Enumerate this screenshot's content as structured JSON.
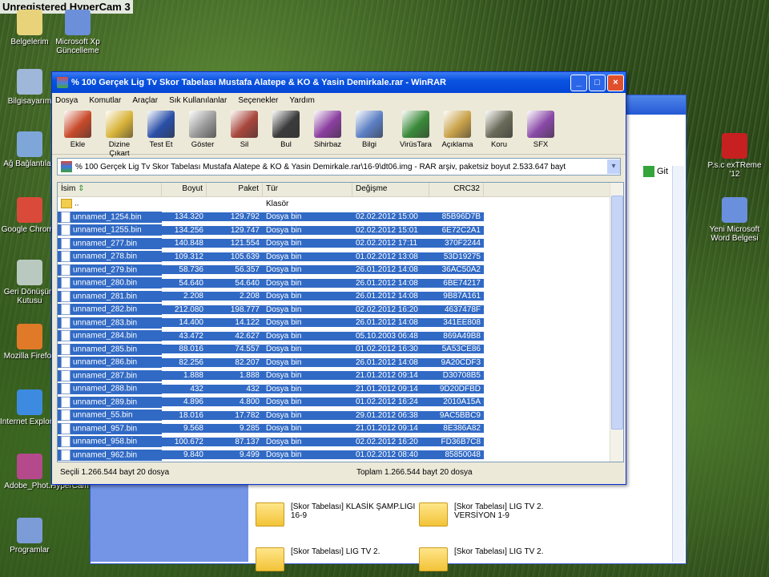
{
  "watermark": "Unregistered HyperCam 3",
  "desktop_icons": [
    {
      "label": "Belgelerim",
      "icon": "documents-icon",
      "color": "#e8d37a"
    },
    {
      "label": "Microsoft Xp Güncelleme",
      "icon": "update-icon",
      "color": "#6b8fd8"
    },
    {
      "label": "Bilgisayarım",
      "icon": "computer-icon",
      "color": "#9fb7d8"
    },
    {
      "label": "Ağ Bağlantıları",
      "icon": "network-icon",
      "color": "#7fa6d8"
    },
    {
      "label": "Google Chrome",
      "icon": "chrome-icon",
      "color": "#d94a3a"
    },
    {
      "label": "Geri Dönüşüm Kutusu",
      "icon": "recycle-bin-icon",
      "color": "#b9c9c0"
    },
    {
      "label": "Mozilla Firefox",
      "icon": "firefox-icon",
      "color": "#e07a28"
    },
    {
      "label": "Internet Explorer",
      "icon": "ie-icon",
      "color": "#3d8be0"
    },
    {
      "label": "Adobe_Phot...",
      "icon": "winrar-archive-icon",
      "color": "#b44a8c"
    },
    {
      "label": "HyperCam",
      "icon": "hypercam-icon",
      "color": "#445"
    },
    {
      "label": "Programlar",
      "icon": "programs-icon",
      "color": "#7c9cd8"
    },
    {
      "label": "P.s.c exTReme '12",
      "icon": "psc-icon",
      "color": "#c62020"
    },
    {
      "label": "Yeni Microsoft Word Belgesi",
      "icon": "word-doc-icon",
      "color": "#6a8fdc"
    }
  ],
  "bg_window": {
    "go_label": "Git",
    "folders": [
      "[Skor Tabelası] KLASİK ŞAMP.LIGI 16-9",
      "[Skor Tabelası] LIG TV 2. VERSİYON 1-9",
      "[Skor Tabelası] LIG TV 2.",
      "[Skor Tabelası] LIG TV 2."
    ]
  },
  "rar": {
    "title": "% 100 Gerçek Lig Tv Skor Tabelası Mustafa Alatepe & KO & Yasin Demirkale.rar - WinRAR",
    "menu": [
      "Dosya",
      "Komutlar",
      "Araçlar",
      "Sık Kullanılanlar",
      "Seçenekler",
      "Yardım"
    ],
    "tools": [
      {
        "label": "Ekle",
        "icon": "add-icon",
        "color": "#c84a2a"
      },
      {
        "label": "Dizine Çıkart",
        "icon": "extract-icon",
        "color": "#d9b43a"
      },
      {
        "label": "Test Et",
        "icon": "test-icon",
        "color": "#2a4fa8"
      },
      {
        "label": "Göster",
        "icon": "view-icon",
        "color": "#9a9a9a"
      },
      {
        "label": "Sil",
        "icon": "delete-icon",
        "color": "#a8463c"
      },
      {
        "label": "Bul",
        "icon": "find-icon",
        "color": "#3b3b3b"
      },
      {
        "label": "Sihirbaz",
        "icon": "wizard-icon",
        "color": "#8b3fa0"
      },
      {
        "label": "Bilgi",
        "icon": "info-icon",
        "color": "#5c7fc4"
      },
      {
        "label": "VirüsTara",
        "icon": "virus-scan-icon",
        "color": "#3b8a3a"
      },
      {
        "label": "Açıklama",
        "icon": "comment-icon",
        "color": "#c9a24a"
      },
      {
        "label": "Koru",
        "icon": "protect-icon",
        "color": "#6b6b5a"
      },
      {
        "label": "SFX",
        "icon": "sfx-icon",
        "color": "#8a4aa8"
      }
    ],
    "address": "% 100 Gerçek Lig Tv Skor Tabelası Mustafa Alatepe & KO & Yasin Demirkale.rar\\16-9\\dt06.img - RAR arşiv, paketsiz boyut 2.533.647 bayt",
    "columns": [
      "İsim",
      "Boyut",
      "Paket",
      "Tür",
      "Değişme",
      "CRC32"
    ],
    "parent_row": {
      "name": "..",
      "type": "Klasör"
    },
    "files": [
      [
        "unnamed_1254.bin",
        "134.320",
        "129.792",
        "Dosya bin",
        "02.02.2012 15:00",
        "85B96D7B"
      ],
      [
        "unnamed_1255.bin",
        "134.256",
        "129.747",
        "Dosya bin",
        "02.02.2012 15:01",
        "6E72C2A1"
      ],
      [
        "unnamed_277.bin",
        "140.848",
        "121.554",
        "Dosya bin",
        "02.02.2012 17:11",
        "370F2244"
      ],
      [
        "unnamed_278.bin",
        "109.312",
        "105.639",
        "Dosya bin",
        "01.02.2012 13:08",
        "53D19275"
      ],
      [
        "unnamed_279.bin",
        "58.736",
        "56.357",
        "Dosya bin",
        "26.01.2012 14:08",
        "36AC50A2"
      ],
      [
        "unnamed_280.bin",
        "54.640",
        "54.640",
        "Dosya bin",
        "26.01.2012 14:08",
        "6BE74217"
      ],
      [
        "unnamed_281.bin",
        "2.208",
        "2.208",
        "Dosya bin",
        "26.01.2012 14:08",
        "9B87A161"
      ],
      [
        "unnamed_282.bin",
        "212.080",
        "198.777",
        "Dosya bin",
        "02.02.2012 16:20",
        "4637478F"
      ],
      [
        "unnamed_283.bin",
        "14.400",
        "14.122",
        "Dosya bin",
        "26.01.2012 14:08",
        "341EE808"
      ],
      [
        "unnamed_284.bin",
        "43.472",
        "42.627",
        "Dosya bin",
        "05.10.2003 06:48",
        "869A49B8"
      ],
      [
        "unnamed_285.bin",
        "88.016",
        "74.557",
        "Dosya bin",
        "01.02.2012 16:30",
        "5A53CE86"
      ],
      [
        "unnamed_286.bin",
        "82.256",
        "82.207",
        "Dosya bin",
        "26.01.2012 14:08",
        "9A20CDF3"
      ],
      [
        "unnamed_287.bin",
        "1.888",
        "1.888",
        "Dosya bin",
        "21.01.2012 09:14",
        "D30708B5"
      ],
      [
        "unnamed_288.bin",
        "432",
        "432",
        "Dosya bin",
        "21.01.2012 09:14",
        "9D20DFBD"
      ],
      [
        "unnamed_289.bin",
        "4.896",
        "4.800",
        "Dosya bin",
        "01.02.2012 16:24",
        "2010A15A"
      ],
      [
        "unnamed_55.bin",
        "18.016",
        "17.782",
        "Dosya bin",
        "29.01.2012 06:38",
        "9AC5BBC9"
      ],
      [
        "unnamed_957.bin",
        "9.568",
        "9.285",
        "Dosya bin",
        "21.01.2012 09:14",
        "8E386A82"
      ],
      [
        "unnamed_958.bin",
        "100.672",
        "87.137",
        "Dosya bin",
        "02.02.2012 16:20",
        "FD36B7C8"
      ],
      [
        "unnamed_962.bin",
        "9.840",
        "9.499",
        "Dosya bin",
        "01.02.2012 08:40",
        "85850048"
      ]
    ],
    "status_selected": "Seçili 1.266.544 bayt 20 dosya",
    "status_total": "Toplam 1.266.544 bayt 20 dosya"
  }
}
